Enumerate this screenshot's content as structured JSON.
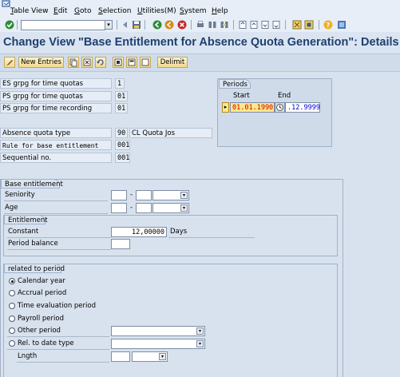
{
  "menu": {
    "items": [
      "Table View",
      "Edit",
      "Goto",
      "Selection",
      "Utilities(M)",
      "System",
      "Help"
    ]
  },
  "title": "Change View \"Base Entitlement for Absence Quota Generation\": Details",
  "app_toolbar": {
    "new_entries": "New Entries",
    "delimit": "Delimit"
  },
  "header_fields": {
    "es_grpg": {
      "label": "ES grpg for time quotas",
      "value": "1"
    },
    "ps_grpg_quotas": {
      "label": "PS grpg for time quotas",
      "value": "01"
    },
    "ps_grpg_recording": {
      "label": "PS grpg for time recording",
      "value": "01"
    },
    "absence_quota_type": {
      "label": "Absence quota type",
      "value": "90",
      "text": "CL Quota Jos"
    },
    "rule": {
      "label": "Rule for base entitlement",
      "value": "001"
    },
    "sequential": {
      "label": "Sequential no.",
      "value": "001"
    }
  },
  "periods": {
    "title": "Periods",
    "start_label": "Start",
    "end_label": "End",
    "start_value": "01.01.1990",
    "end_value": ".12.9999"
  },
  "base_entitlement": {
    "title": "Base entitlement",
    "seniority_label": "Seniority",
    "age_label": "Age",
    "dash": "-"
  },
  "entitlement": {
    "title": "Entitlement",
    "constant_label": "Constant",
    "constant_value": "12,00000",
    "constant_unit": "Days",
    "period_balance_label": "Period balance"
  },
  "related": {
    "title": "related to period",
    "options": [
      "Calendar year",
      "Accrual period",
      "Time evaluation period",
      "Payroll period",
      "Other period",
      "Rel. to date type"
    ],
    "selected": "Calendar year",
    "lngth_label": "Lngth"
  },
  "colors": {
    "title": "#1f3f70",
    "background": "#d8e2ee",
    "highlight": "#ffe98a",
    "date_red": "#cc0000",
    "date_blue": "#0000cc"
  }
}
